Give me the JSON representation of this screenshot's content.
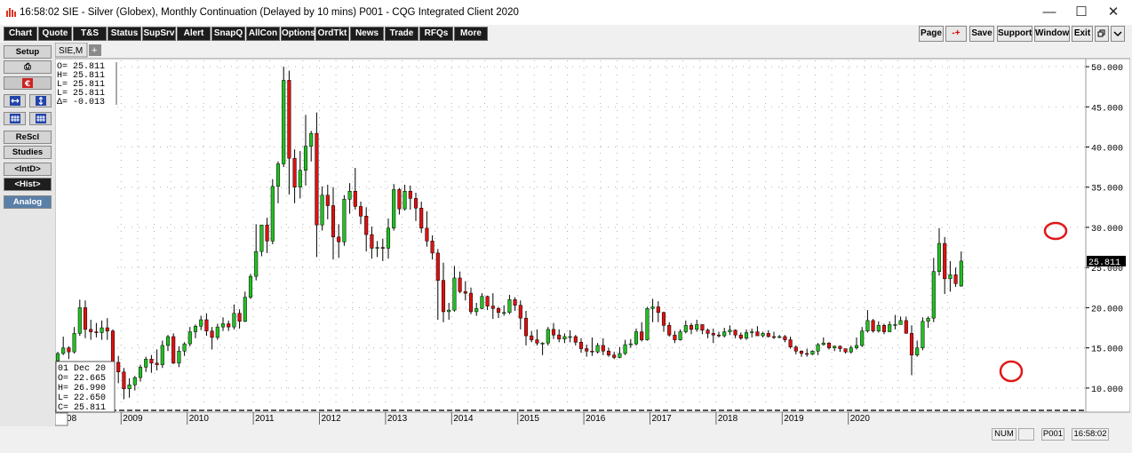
{
  "window": {
    "title": "16:58:02  SIE - Silver (Globex), Monthly Continuation (Delayed by 10 mins)   P001 - CQG Integrated Client 2020",
    "minimize": "—",
    "maximize": "☐",
    "close": "✕"
  },
  "toolbar": {
    "items": [
      "Chart",
      "Quote",
      "T&S",
      "Status",
      "SupSrv",
      "Alert",
      "SnapQ",
      "AllCon",
      "Options",
      "OrdTkt",
      "News",
      "Trade",
      "RFQs",
      "More"
    ],
    "right_items": [
      "Page",
      "-+",
      "Save",
      "Support",
      "Window",
      "Exit"
    ]
  },
  "tabs": {
    "active": "SIE,M",
    "add": "+"
  },
  "sidebar": {
    "setup": "Setup",
    "print_icon": "⎙",
    "resc": "ReScl",
    "studies": "Studies",
    "intd": "<IntD>",
    "hist": "<Hist>",
    "analog": "Analog"
  },
  "chart_data": {
    "type": "candlestick",
    "symbol": "SIE,M",
    "interval": "monthly",
    "ohlc_box": {
      "o": "O= 25.811",
      "h": "H= 25.811",
      "l": "L= 25.811",
      "l2": "L= 25.811",
      "d": "Δ= -0.013"
    },
    "cursor_box": {
      "date": "01 Dec 20",
      "o": "O=    22.665",
      "h": "H=    26.990",
      "l": "L=    22.650",
      "c": "C=    25.811"
    },
    "last_price": "25.811",
    "y_ticks": [
      "50.000",
      "45.000",
      "40.000",
      "35.000",
      "30.000",
      "25.000",
      "20.000",
      "15.000",
      "10.000"
    ],
    "y_tick_values": [
      50,
      45,
      40,
      35,
      30,
      25,
      20,
      15,
      10
    ],
    "ylim": [
      7,
      51
    ],
    "x_labels": [
      "2008",
      "2009",
      "2010",
      "2011",
      "2012",
      "2013",
      "2014",
      "2015",
      "2016",
      "2017",
      "2018",
      "2019",
      "2020"
    ],
    "x_start_year": 2008,
    "colors": {
      "up": "#22c022",
      "down": "#dd1111",
      "annotation": "#e01818",
      "grid": "#b0b0b0"
    },
    "candles": [
      [
        13.4,
        14.5,
        13.2,
        14.3
      ],
      [
        14.3,
        16.4,
        14.1,
        15.0
      ],
      [
        15.0,
        15.2,
        13.6,
        14.5
      ],
      [
        14.5,
        17.6,
        14.3,
        16.8
      ],
      [
        16.8,
        21.0,
        16.5,
        20.0
      ],
      [
        20.0,
        20.9,
        16.2,
        17.3
      ],
      [
        17.3,
        18.5,
        16.0,
        17.0
      ],
      [
        17.0,
        18.1,
        16.3,
        16.9
      ],
      [
        16.9,
        18.4,
        16.0,
        17.5
      ],
      [
        17.5,
        18.7,
        16.0,
        17.1
      ],
      [
        17.1,
        17.3,
        12.5,
        13.2
      ],
      [
        13.2,
        14.0,
        10.6,
        12.0
      ],
      [
        12.0,
        12.5,
        8.6,
        9.9
      ],
      [
        9.9,
        11.2,
        8.8,
        10.4
      ],
      [
        10.4,
        11.5,
        9.7,
        11.3
      ],
      [
        11.3,
        12.9,
        10.8,
        12.6
      ],
      [
        12.6,
        13.9,
        12.0,
        13.6
      ],
      [
        13.6,
        14.1,
        11.9,
        13.1
      ],
      [
        13.1,
        14.8,
        12.2,
        12.9
      ],
      [
        12.9,
        15.9,
        12.5,
        15.3
      ],
      [
        15.3,
        16.6,
        14.6,
        16.4
      ],
      [
        16.4,
        16.8,
        13.0,
        13.1
      ],
      [
        13.1,
        15.2,
        12.6,
        14.6
      ],
      [
        14.6,
        15.7,
        14.0,
        15.5
      ],
      [
        15.5,
        17.6,
        15.2,
        17.0
      ],
      [
        17.0,
        17.9,
        16.2,
        17.7
      ],
      [
        17.7,
        19.0,
        17.2,
        18.5
      ],
      [
        18.5,
        19.3,
        16.5,
        17.1
      ],
      [
        17.1,
        17.6,
        14.8,
        16.3
      ],
      [
        16.3,
        18.0,
        16.0,
        17.6
      ],
      [
        17.6,
        18.8,
        17.1,
        18.0
      ],
      [
        18.0,
        18.4,
        17.1,
        17.6
      ],
      [
        17.6,
        20.4,
        17.3,
        19.3
      ],
      [
        19.3,
        19.8,
        17.4,
        18.3
      ],
      [
        18.3,
        22.0,
        18.2,
        21.3
      ],
      [
        21.3,
        24.2,
        21.1,
        23.9
      ],
      [
        23.9,
        30.4,
        23.4,
        27.0
      ],
      [
        27.0,
        30.3,
        26.4,
        30.3
      ],
      [
        30.3,
        31.2,
        26.8,
        28.3
      ],
      [
        28.3,
        36.0,
        27.9,
        35.1
      ],
      [
        35.1,
        38.2,
        33.0,
        37.9
      ],
      [
        37.9,
        50.0,
        37.5,
        48.3
      ],
      [
        48.3,
        49.5,
        34.1,
        38.6
      ],
      [
        38.6,
        39.7,
        33.0,
        35.0
      ],
      [
        35.0,
        39.5,
        33.6,
        37.1
      ],
      [
        37.1,
        44.0,
        35.2,
        40.1
      ],
      [
        40.1,
        42.0,
        38.2,
        41.7
      ],
      [
        41.7,
        44.3,
        26.3,
        30.3
      ],
      [
        30.3,
        35.1,
        29.6,
        34.0
      ],
      [
        34.0,
        35.3,
        31.0,
        32.7
      ],
      [
        32.7,
        35.0,
        26.0,
        28.8
      ],
      [
        28.8,
        30.4,
        26.2,
        28.2
      ],
      [
        28.2,
        34.0,
        27.7,
        33.5
      ],
      [
        33.5,
        35.5,
        31.7,
        34.5
      ],
      [
        34.5,
        37.4,
        32.2,
        32.6
      ],
      [
        32.6,
        33.2,
        30.4,
        31.4
      ],
      [
        31.4,
        32.5,
        27.0,
        29.1
      ],
      [
        29.1,
        30.1,
        26.1,
        27.4
      ],
      [
        27.4,
        28.3,
        26.3,
        27.5
      ],
      [
        27.5,
        28.6,
        25.8,
        27.4
      ],
      [
        27.4,
        31.1,
        26.1,
        29.9
      ],
      [
        29.9,
        35.4,
        29.6,
        34.7
      ],
      [
        34.7,
        34.9,
        31.6,
        32.3
      ],
      [
        32.3,
        35.3,
        32.1,
        34.5
      ],
      [
        34.5,
        35.2,
        32.2,
        33.6
      ],
      [
        33.6,
        34.3,
        30.8,
        32.4
      ],
      [
        32.4,
        33.2,
        29.3,
        29.9
      ],
      [
        29.9,
        32.0,
        27.6,
        28.3
      ],
      [
        28.3,
        29.0,
        26.0,
        26.8
      ],
      [
        26.8,
        27.3,
        18.5,
        23.4
      ],
      [
        23.4,
        25.6,
        18.2,
        19.5
      ],
      [
        19.5,
        20.6,
        18.5,
        19.7
      ],
      [
        19.7,
        25.2,
        19.5,
        23.7
      ],
      [
        23.7,
        24.5,
        21.8,
        22.0
      ],
      [
        22.0,
        23.3,
        20.9,
        21.8
      ],
      [
        21.8,
        22.5,
        19.2,
        19.5
      ],
      [
        19.5,
        20.6,
        19.0,
        19.9
      ],
      [
        19.9,
        21.8,
        19.8,
        21.4
      ],
      [
        21.4,
        21.5,
        19.7,
        20.2
      ],
      [
        20.2,
        21.8,
        18.6,
        19.9
      ],
      [
        19.9,
        20.1,
        18.7,
        19.4
      ],
      [
        19.4,
        20.3,
        19.0,
        19.4
      ],
      [
        19.4,
        21.6,
        19.2,
        21.0
      ],
      [
        21.0,
        21.3,
        19.6,
        20.3
      ],
      [
        20.3,
        20.9,
        17.3,
        18.7
      ],
      [
        18.7,
        19.6,
        15.3,
        16.5
      ],
      [
        16.5,
        17.1,
        15.7,
        16.0
      ],
      [
        16.0,
        17.3,
        15.3,
        15.6
      ],
      [
        15.6,
        15.7,
        14.1,
        15.6
      ],
      [
        15.6,
        17.6,
        15.3,
        17.3
      ],
      [
        17.3,
        18.1,
        16.1,
        16.6
      ],
      [
        16.6,
        17.3,
        15.7,
        16.1
      ],
      [
        16.1,
        16.8,
        15.6,
        16.4
      ],
      [
        16.4,
        17.2,
        15.7,
        16.4
      ],
      [
        16.4,
        16.6,
        15.3,
        15.7
      ],
      [
        15.7,
        16.2,
        14.4,
        14.9
      ],
      [
        14.9,
        15.4,
        13.9,
        14.6
      ],
      [
        14.6,
        16.3,
        14.0,
        14.5
      ],
      [
        14.5,
        15.6,
        14.3,
        15.3
      ],
      [
        15.3,
        16.2,
        14.1,
        14.6
      ],
      [
        14.6,
        15.0,
        13.9,
        14.1
      ],
      [
        14.1,
        14.5,
        13.6,
        13.8
      ],
      [
        13.8,
        15.1,
        13.7,
        14.3
      ],
      [
        14.3,
        16.0,
        14.1,
        15.4
      ],
      [
        15.4,
        16.1,
        15.0,
        15.5
      ],
      [
        15.5,
        17.4,
        15.3,
        17.0
      ],
      [
        17.0,
        18.2,
        15.8,
        16.0
      ],
      [
        16.0,
        20.1,
        15.9,
        19.9
      ],
      [
        19.9,
        21.1,
        18.2,
        20.1
      ],
      [
        20.1,
        20.8,
        18.2,
        19.4
      ],
      [
        19.4,
        19.5,
        17.0,
        17.8
      ],
      [
        17.8,
        18.2,
        16.4,
        16.6
      ],
      [
        16.6,
        17.1,
        15.6,
        16.0
      ],
      [
        16.0,
        17.3,
        15.9,
        17.0
      ],
      [
        17.0,
        18.4,
        16.8,
        17.8
      ],
      [
        17.8,
        18.1,
        16.7,
        17.3
      ],
      [
        17.3,
        18.5,
        17.0,
        17.9
      ],
      [
        17.9,
        17.9,
        16.7,
        17.2
      ],
      [
        17.2,
        17.4,
        16.2,
        16.8
      ],
      [
        16.8,
        17.4,
        15.6,
        16.6
      ],
      [
        16.6,
        17.0,
        16.3,
        16.5
      ],
      [
        16.5,
        17.5,
        16.3,
        17.0
      ],
      [
        17.0,
        17.8,
        16.6,
        17.2
      ],
      [
        17.2,
        17.3,
        16.2,
        16.6
      ],
      [
        16.6,
        16.9,
        16.0,
        16.2
      ],
      [
        16.2,
        17.3,
        16.0,
        16.9
      ],
      [
        16.9,
        17.4,
        16.3,
        17.0
      ],
      [
        17.0,
        17.7,
        16.5,
        16.5
      ],
      [
        16.5,
        17.0,
        16.3,
        16.8
      ],
      [
        16.8,
        17.2,
        16.3,
        16.4
      ],
      [
        16.4,
        17.0,
        16.1,
        16.3
      ],
      [
        16.3,
        16.6,
        16.2,
        16.4
      ],
      [
        16.4,
        16.6,
        15.7,
        16.0
      ],
      [
        16.0,
        16.4,
        14.9,
        15.1
      ],
      [
        15.1,
        15.3,
        14.2,
        14.6
      ],
      [
        14.6,
        14.7,
        13.9,
        14.3
      ],
      [
        14.3,
        14.9,
        13.9,
        14.2
      ],
      [
        14.2,
        14.7,
        14.1,
        14.6
      ],
      [
        14.6,
        15.6,
        14.1,
        15.4
      ],
      [
        15.4,
        16.3,
        15.3,
        15.6
      ],
      [
        15.6,
        15.7,
        14.8,
        15.0
      ],
      [
        15.0,
        15.3,
        14.6,
        15.2
      ],
      [
        15.2,
        15.3,
        14.5,
        14.9
      ],
      [
        14.9,
        14.9,
        14.3,
        14.5
      ],
      [
        14.5,
        15.3,
        14.3,
        15.0
      ],
      [
        15.0,
        16.3,
        14.8,
        15.3
      ],
      [
        15.3,
        17.6,
        15.1,
        17.1
      ],
      [
        17.1,
        19.7,
        16.9,
        18.4
      ],
      [
        18.4,
        18.6,
        16.9,
        17.1
      ],
      [
        17.1,
        18.3,
        16.9,
        17.8
      ],
      [
        17.8,
        18.0,
        16.7,
        17.0
      ],
      [
        17.0,
        18.3,
        17.0,
        17.9
      ],
      [
        17.9,
        19.1,
        17.3,
        17.9
      ],
      [
        17.9,
        18.9,
        17.9,
        18.4
      ],
      [
        18.4,
        18.9,
        16.8,
        16.8
      ],
      [
        16.8,
        17.8,
        11.6,
        14.1
      ],
      [
        14.1,
        15.9,
        13.9,
        15.0
      ],
      [
        15.0,
        18.8,
        14.7,
        18.3
      ],
      [
        18.3,
        18.9,
        17.5,
        18.7
      ],
      [
        18.7,
        26.2,
        18.2,
        24.5
      ],
      [
        24.5,
        29.9,
        24.0,
        28.0
      ],
      [
        28.0,
        28.8,
        21.7,
        23.6
      ],
      [
        23.6,
        25.8,
        22.0,
        24.1
      ],
      [
        24.1,
        25.0,
        22.6,
        23.0
      ],
      [
        22.7,
        27.0,
        22.6,
        25.8
      ]
    ]
  }
}
